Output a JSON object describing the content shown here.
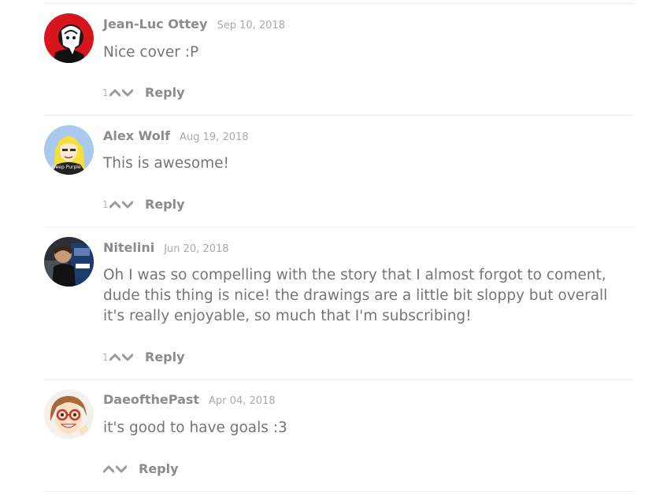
{
  "comments": [
    {
      "author": "Jean-Luc Ottey",
      "date": "Sep 10, 2018",
      "text": "Nice cover :P",
      "votes": "1",
      "reply_label": "Reply"
    },
    {
      "author": "Alex Wolf",
      "date": "Aug 19, 2018",
      "text": "This is awesome!",
      "votes": "1",
      "reply_label": "Reply",
      "avatar_caption": "Deep Purple"
    },
    {
      "author": "Nitelini",
      "date": "Jun 20, 2018",
      "text": "Oh I was so compelling with the story that I almost forgot to coment, dude this thing is nice! the drawings are a little bit sloppy but overall it's really enjoyable, so much that I'm subscribing!",
      "votes": "1",
      "reply_label": "Reply"
    },
    {
      "author": "DaeofthePast",
      "date": "Apr 04, 2018",
      "text": "it's good to have goals :3",
      "votes": "",
      "reply_label": "Reply"
    }
  ],
  "icons": {
    "upvote": "chevron-up-icon",
    "downvote": "chevron-down-icon"
  },
  "colors": {
    "author": "#8b8b8b",
    "date": "#a9a9a9",
    "text": "#757575",
    "divider": "#ececec"
  }
}
